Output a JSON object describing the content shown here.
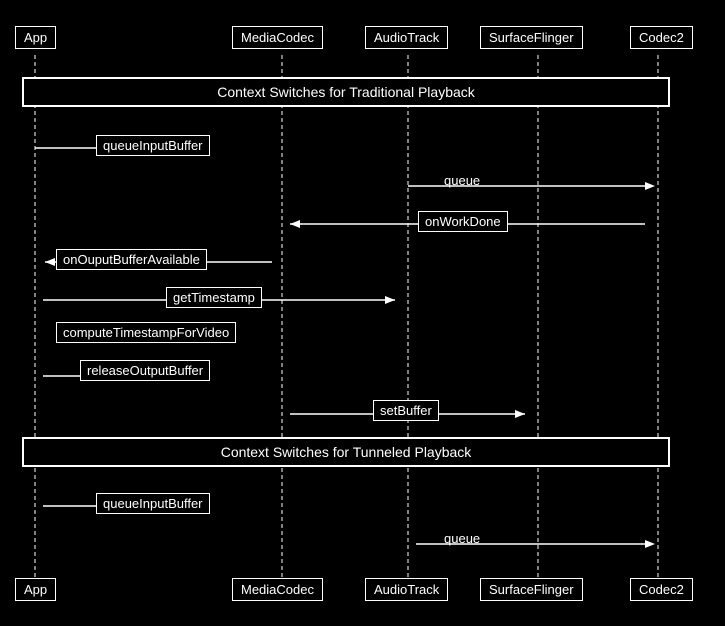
{
  "header_actors": {
    "app": "App",
    "mediacodec": "MediaCodec",
    "audiotrack": "AudioTrack",
    "surfaceflinger": "SurfaceFlinger",
    "codec2": "Codec2"
  },
  "footer_actors": {
    "app": "App",
    "mediacodec": "MediaCodec",
    "audiotrack": "AudioTrack",
    "surfaceflinger": "SurfaceFlinger",
    "codec2": "Codec2"
  },
  "section1": {
    "title": "Context Switches for Traditional Playback"
  },
  "section2": {
    "title": "Context Switches for Tunneled Playback"
  },
  "calls": {
    "queueInputBuffer1": "queueInputBuffer",
    "queue1": "queue",
    "onWorkDone": "onWorkDone",
    "onOuputBufferAvailable": "onOuputBufferAvailable",
    "getTimestamp": "getTimestamp",
    "computeTimestampForVideo": "computeTimestampForVideo",
    "releaseOutputBuffer": "releaseOutputBuffer",
    "setBuffer": "setBuffer",
    "queueInputBuffer2": "queueInputBuffer",
    "queue2": "queue"
  }
}
